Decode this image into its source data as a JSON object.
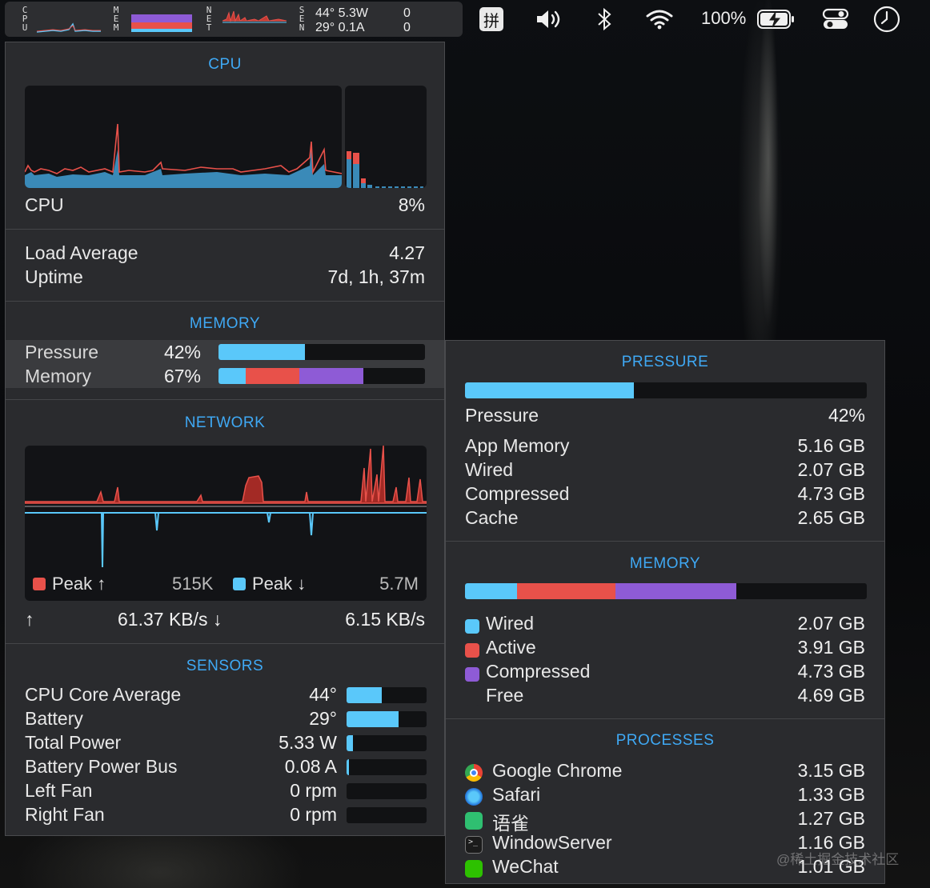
{
  "menubar": {
    "cpu_label": [
      "C",
      "P",
      "U"
    ],
    "mem_label": [
      "M",
      "E",
      "M"
    ],
    "net_label": [
      "N",
      "E",
      "T"
    ],
    "sen_label": [
      "S",
      "E",
      "N"
    ],
    "sen_row1": "44°  5.3W",
    "sen_row2": "29°  0.1A",
    "sen_row1b": "0",
    "sen_row2b": "0",
    "input_method": "拼",
    "battery_pct": "100%",
    "icons": [
      "volume-icon",
      "bluetooth-icon",
      "wifi-icon",
      "battery-charging-icon",
      "control-center-icon",
      "clock-icon"
    ]
  },
  "left": {
    "cpu_title": "CPU",
    "cpu_label": "CPU",
    "cpu_value": "8%",
    "load_label": "Load Average",
    "load_value": "4.27",
    "uptime_label": "Uptime",
    "uptime_value": "7d, 1h, 37m",
    "memory_title": "MEMORY",
    "pressure_label": "Pressure",
    "pressure_value": "42%",
    "pressure_fraction": 0.42,
    "memory_label": "Memory",
    "memory_value": "67%",
    "memory_segments": [
      0.13,
      0.26,
      0.31
    ],
    "network_title": "NETWORK",
    "peak_up_label": "Peak ↑",
    "peak_up_value": "515K",
    "peak_down_label": "Peak ↓",
    "peak_down_value": "5.7M",
    "up_arrow": "↑",
    "up_rate": "61.37 KB/s ↓",
    "down_rate": "6.15 KB/s",
    "sensors_title": "SENSORS",
    "sensors": [
      {
        "label": "CPU Core Average",
        "value": "44°",
        "fraction": 0.44
      },
      {
        "label": "Battery",
        "value": "29°",
        "fraction": 0.65
      },
      {
        "label": "Total Power",
        "value": "5.33 W",
        "fraction": 0.08
      },
      {
        "label": "Battery Power Bus",
        "value": "0.08 A",
        "fraction": 0.02
      },
      {
        "label": "Left Fan",
        "value": "0 rpm",
        "fraction": 0
      },
      {
        "label": "Right Fan",
        "value": "0 rpm",
        "fraction": 0
      }
    ]
  },
  "right": {
    "pressure_title": "PRESSURE",
    "pressure_fraction": 0.42,
    "pressure_label": "Pressure",
    "pressure_value": "42%",
    "details": [
      {
        "label": "App Memory",
        "value": "5.16 GB"
      },
      {
        "label": "Wired",
        "value": "2.07 GB"
      },
      {
        "label": "Compressed",
        "value": "4.73 GB"
      },
      {
        "label": "Cache",
        "value": "2.65 GB"
      }
    ],
    "memory_title": "MEMORY",
    "memory_segments": [
      0.13,
      0.245,
      0.3
    ],
    "memory_rows": [
      {
        "label": "Wired",
        "value": "2.07 GB",
        "color": "#5ac8fa"
      },
      {
        "label": "Active",
        "value": "3.91 GB",
        "color": "#e8514a"
      },
      {
        "label": "Compressed",
        "value": "4.73 GB",
        "color": "#8e5bd6"
      },
      {
        "label": "Free",
        "value": "4.69 GB",
        "color": "#2a2b2e"
      }
    ],
    "processes_title": "PROCESSES",
    "processes": [
      {
        "name": "Google Chrome",
        "value": "3.15 GB",
        "icon": "chrome-icon"
      },
      {
        "name": "Safari",
        "value": "1.33 GB",
        "icon": "safari-icon"
      },
      {
        "name": "语雀",
        "value": "1.27 GB",
        "icon": "yuque-icon"
      },
      {
        "name": "WindowServer",
        "value": "1.16 GB",
        "icon": "terminal-icon"
      },
      {
        "name": "WeChat",
        "value": "1.01 GB",
        "icon": "wechat-icon"
      }
    ]
  },
  "colors": {
    "accent": "#3fa9f5",
    "cyan": "#5ac8fa",
    "red": "#e8514a",
    "purple": "#8e5bd6"
  },
  "watermark": "@稀土掘金技术社区"
}
